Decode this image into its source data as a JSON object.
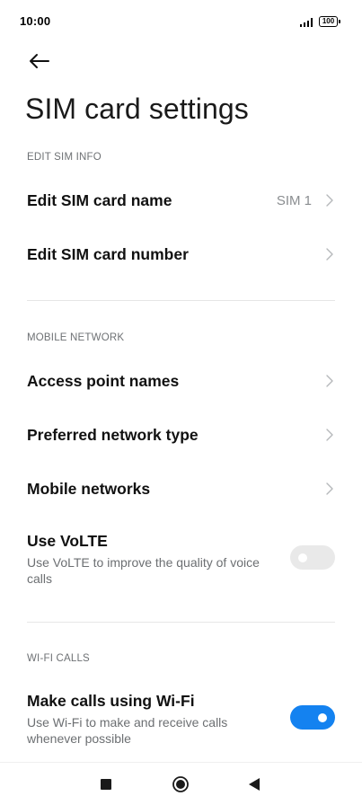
{
  "status_bar": {
    "time": "10:00",
    "battery_level": "100",
    "signal_icon": "signal-bars-icon",
    "battery_icon": "battery-icon"
  },
  "header": {
    "back_icon": "arrow-left-icon",
    "title": "SIM card settings"
  },
  "sections": {
    "edit_sim_info": {
      "header": "EDIT SIM INFO",
      "items": [
        {
          "title": "Edit SIM card name",
          "value": "SIM 1"
        },
        {
          "title": "Edit SIM card number",
          "value": ""
        }
      ]
    },
    "mobile_network": {
      "header": "MOBILE NETWORK",
      "items": [
        {
          "title": "Access point names"
        },
        {
          "title": "Preferred network type"
        },
        {
          "title": "Mobile networks"
        }
      ],
      "volte": {
        "title": "Use VoLTE",
        "subtitle": "Use VoLTE to improve the quality of voice calls",
        "enabled": false
      }
    },
    "wifi_calls": {
      "header": "WI-FI CALLS",
      "wifi_calling": {
        "title": "Make calls using Wi-Fi",
        "subtitle": "Use Wi-Fi to make and receive calls whenever possible",
        "enabled": true
      }
    }
  },
  "colors": {
    "accent": "#1482f0",
    "toggle_off": "#e9e9e9",
    "section_header": "#6e7174",
    "secondary_text": "#6c6f72"
  },
  "nav_bar": {
    "recents_icon": "square-recents-icon",
    "home_icon": "circle-home-icon",
    "back_icon": "triangle-back-icon"
  }
}
